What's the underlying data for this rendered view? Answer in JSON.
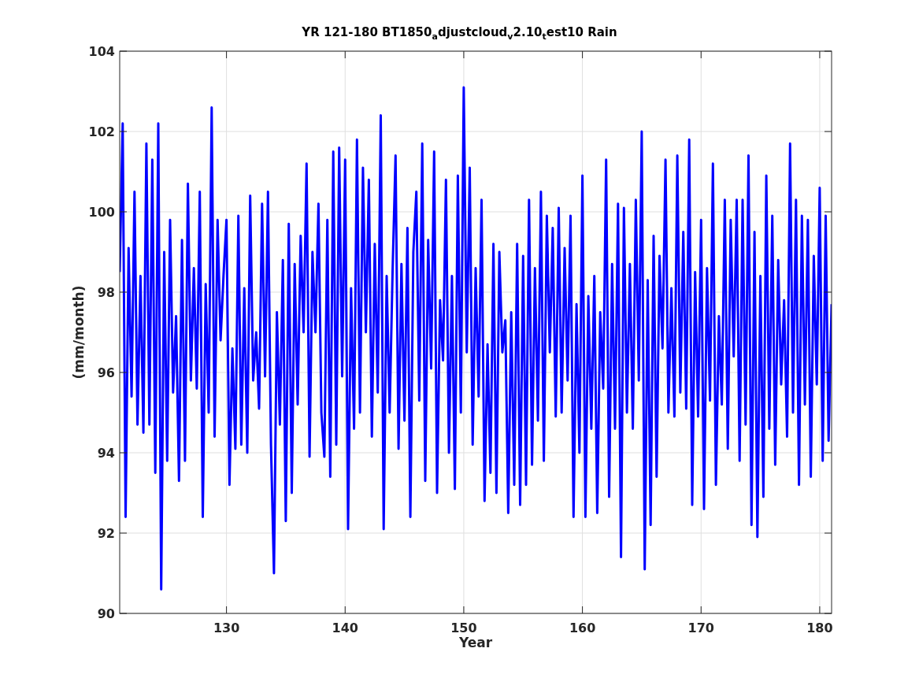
{
  "figure": {
    "chart_data": {
      "type": "line",
      "title": "YR 121-180 BT1850$_{a}$djustcloud$_{v}$2.10$_{t}$est10 Rain",
      "xlabel": "Year",
      "ylabel": "(mm/month)",
      "xlim": [
        121,
        181
      ],
      "ylim": [
        90,
        104
      ],
      "grid": true,
      "xticks": [
        130,
        140,
        150,
        160,
        170,
        180
      ],
      "yticks": [
        90,
        92,
        94,
        96,
        98,
        100,
        102,
        104
      ],
      "x": [
        121,
        121.25,
        121.5,
        121.75,
        122,
        122.25,
        122.5,
        122.75,
        123,
        123.25,
        123.5,
        123.75,
        124,
        124.25,
        124.5,
        124.75,
        125,
        125.25,
        125.5,
        125.75,
        126,
        126.25,
        126.5,
        126.75,
        127,
        127.25,
        127.5,
        127.75,
        128,
        128.25,
        128.5,
        128.75,
        129,
        129.25,
        129.5,
        129.75,
        130,
        130.25,
        130.5,
        130.75,
        131,
        131.25,
        131.5,
        131.75,
        132,
        132.25,
        132.5,
        132.75,
        133,
        133.25,
        133.5,
        133.75,
        134,
        134.25,
        134.5,
        134.75,
        135,
        135.25,
        135.5,
        135.75,
        136,
        136.25,
        136.5,
        136.75,
        137,
        137.25,
        137.5,
        137.75,
        138,
        138.25,
        138.5,
        138.75,
        139,
        139.25,
        139.5,
        139.75,
        140,
        140.25,
        140.5,
        140.75,
        141,
        141.25,
        141.5,
        141.75,
        142,
        142.25,
        142.5,
        142.75,
        143,
        143.25,
        143.5,
        143.75,
        144,
        144.25,
        144.5,
        144.75,
        145,
        145.25,
        145.5,
        145.75,
        146,
        146.25,
        146.5,
        146.75,
        147,
        147.25,
        147.5,
        147.75,
        148,
        148.25,
        148.5,
        148.75,
        149,
        149.25,
        149.5,
        149.75,
        150,
        150.25,
        150.5,
        150.75,
        151,
        151.25,
        151.5,
        151.75,
        152,
        152.25,
        152.5,
        152.75,
        153,
        153.25,
        153.5,
        153.75,
        154,
        154.25,
        154.5,
        154.75,
        155,
        155.25,
        155.5,
        155.75,
        156,
        156.25,
        156.5,
        156.75,
        157,
        157.25,
        157.5,
        157.75,
        158,
        158.25,
        158.5,
        158.75,
        159,
        159.25,
        159.5,
        159.75,
        160,
        160.25,
        160.5,
        160.75,
        161,
        161.25,
        161.5,
        161.75,
        162,
        162.25,
        162.5,
        162.75,
        163,
        163.25,
        163.5,
        163.75,
        164,
        164.25,
        164.5,
        164.75,
        165,
        165.25,
        165.5,
        165.75,
        166,
        166.25,
        166.5,
        166.75,
        167,
        167.25,
        167.5,
        167.75,
        168,
        168.25,
        168.5,
        168.75,
        169,
        169.25,
        169.5,
        169.75,
        170,
        170.25,
        170.5,
        170.75,
        171,
        171.25,
        171.5,
        171.75,
        172,
        172.25,
        172.5,
        172.75,
        173,
        173.25,
        173.5,
        173.75,
        174,
        174.25,
        174.5,
        174.75,
        175,
        175.25,
        175.5,
        175.75,
        176,
        176.25,
        176.5,
        176.75,
        177,
        177.25,
        177.5,
        177.75,
        178,
        178.25,
        178.5,
        178.75,
        179,
        179.25,
        179.5,
        179.75,
        180,
        180.25,
        180.5,
        180.75,
        181
      ],
      "series": [
        {
          "color": "#0000ff",
          "values": [
            98.5,
            102.2,
            92.4,
            99.1,
            95.4,
            100.5,
            94.7,
            98.4,
            94.5,
            101.7,
            94.7,
            101.3,
            93.5,
            102.2,
            90.6,
            99.0,
            93.8,
            99.8,
            95.5,
            97.4,
            93.3,
            99.3,
            93.8,
            100.7,
            95.8,
            98.6,
            95.6,
            100.5,
            92.4,
            98.2,
            95.0,
            102.6,
            94.4,
            99.8,
            96.8,
            98.4,
            99.8,
            93.2,
            96.6,
            94.1,
            99.9,
            94.2,
            98.1,
            94.0,
            100.4,
            95.8,
            97.0,
            95.1,
            100.2,
            95.9,
            100.5,
            94.2,
            91.0,
            97.5,
            94.7,
            98.8,
            92.3,
            99.7,
            93.0,
            98.7,
            95.2,
            99.4,
            97.0,
            101.2,
            93.9,
            99.0,
            97.0,
            100.2,
            95.0,
            93.9,
            99.8,
            93.4,
            101.5,
            94.2,
            101.6,
            95.9,
            101.3,
            92.1,
            98.1,
            94.6,
            101.8,
            95.0,
            101.1,
            97.0,
            100.8,
            94.4,
            99.2,
            95.5,
            102.4,
            92.1,
            98.4,
            95.0,
            98.5,
            101.4,
            94.1,
            98.7,
            94.8,
            99.6,
            92.4,
            99.0,
            100.5,
            95.3,
            101.7,
            93.3,
            99.3,
            96.1,
            101.5,
            93.0,
            97.8,
            96.3,
            100.8,
            94.0,
            98.4,
            93.1,
            100.9,
            95.0,
            103.1,
            96.5,
            101.1,
            94.2,
            98.6,
            95.4,
            100.3,
            92.8,
            96.7,
            93.5,
            99.2,
            93.0,
            99.0,
            96.5,
            97.3,
            92.5,
            97.5,
            93.2,
            99.2,
            92.7,
            98.9,
            93.2,
            100.3,
            93.7,
            98.6,
            94.8,
            100.5,
            93.8,
            99.9,
            96.5,
            99.6,
            94.9,
            100.1,
            95.0,
            99.1,
            95.8,
            99.9,
            92.4,
            97.7,
            94.0,
            100.9,
            92.4,
            97.9,
            94.6,
            98.4,
            92.5,
            97.5,
            95.6,
            101.3,
            92.9,
            98.7,
            94.6,
            100.2,
            91.4,
            100.1,
            95.0,
            98.7,
            94.6,
            100.3,
            95.8,
            102.0,
            91.1,
            98.3,
            92.2,
            99.4,
            93.4,
            98.9,
            96.6,
            101.3,
            95.0,
            98.1,
            94.9,
            101.4,
            95.5,
            99.5,
            95.1,
            101.8,
            92.7,
            98.5,
            94.9,
            99.8,
            92.6,
            98.6,
            95.3,
            101.2,
            93.2,
            97.4,
            95.2,
            100.3,
            94.1,
            99.8,
            96.4,
            100.3,
            93.8,
            100.3,
            94.7,
            101.4,
            92.2,
            99.5,
            91.9,
            98.4,
            92.9,
            100.9,
            94.6,
            99.9,
            93.7,
            98.8,
            95.7,
            97.8,
            94.4,
            101.7,
            95.0,
            100.3,
            93.2,
            99.9,
            95.2,
            99.8,
            93.4,
            98.9,
            95.7,
            100.6,
            93.8,
            99.9,
            94.3,
            97.7
          ]
        }
      ]
    }
  }
}
